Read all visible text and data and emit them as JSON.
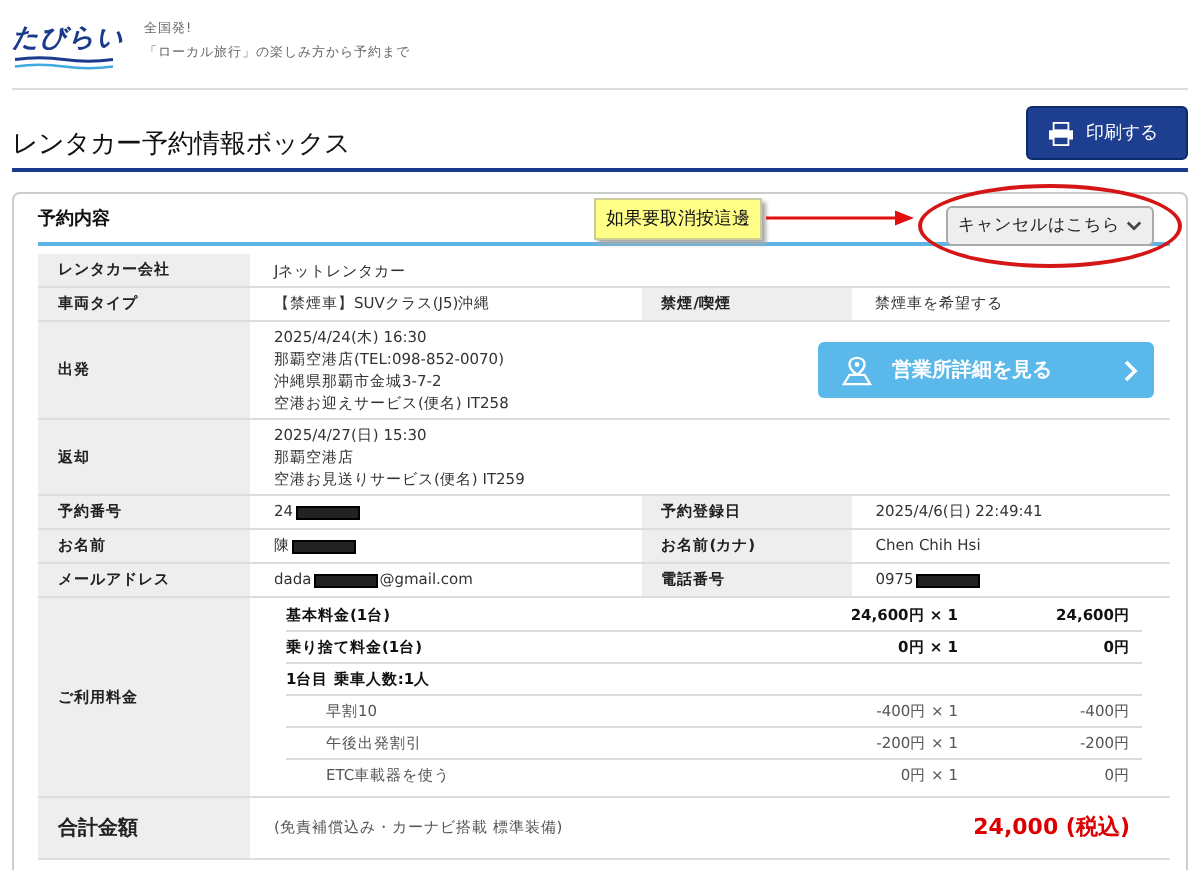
{
  "logo": {
    "text": "たびらい"
  },
  "tagline": [
    "全国発!",
    "「ローカル旅行」の楽しみ方から予約まで"
  ],
  "page_title": "レンタカー予約情報ボックス",
  "print_button": "印刷する",
  "section": {
    "title": "予約内容",
    "cancel_button": "キャンセルはこちら",
    "annotation": "如果要取消按這邊"
  },
  "details": [
    {
      "kind": "single",
      "label": "レンタカー会社",
      "lines": [
        "Jネットレンタカー"
      ]
    },
    {
      "kind": "pair",
      "label": "車両タイプ",
      "value": [
        {
          "kind": "text",
          "text": "【禁煙車】SUVクラス(J5)沖縄"
        }
      ],
      "label2": "禁煙/喫煙",
      "value2": [
        {
          "kind": "text",
          "text": "禁煙車を希望する"
        }
      ]
    },
    {
      "kind": "shop",
      "label": "出発",
      "lines": [
        "2025/4/24(木) 16:30",
        "那覇空港店(TEL:098-852-0070)",
        "沖縄県那覇市金城3-7-2",
        "空港お迎えサービス(便名) IT258"
      ],
      "button": "営業所詳細を見る"
    },
    {
      "kind": "single",
      "label": "返却",
      "lines": [
        "2025/4/27(日) 15:30",
        "那覇空港店",
        "空港お見送りサービス(便名) IT259"
      ]
    },
    {
      "kind": "pair",
      "label": "予約番号",
      "value": [
        {
          "kind": "text",
          "text": "24"
        },
        {
          "kind": "redacted"
        }
      ],
      "label2": "予約登録日",
      "value2": [
        {
          "kind": "text",
          "text": "2025/4/6(日) 22:49:41"
        }
      ]
    },
    {
      "kind": "pair",
      "label": "お名前",
      "value": [
        {
          "kind": "text",
          "text": "陳"
        },
        {
          "kind": "redacted"
        }
      ],
      "label2": "お名前(カナ)",
      "value2": [
        {
          "kind": "text",
          "text": "Chen Chih Hsi"
        }
      ]
    },
    {
      "kind": "pair",
      "label": "メールアドレス",
      "value": [
        {
          "kind": "text",
          "text": "dada"
        },
        {
          "kind": "redacted"
        },
        {
          "kind": "text",
          "text": "@gmail.com"
        }
      ],
      "label2": "電話番号",
      "value2": [
        {
          "kind": "text",
          "text": "0975"
        },
        {
          "kind": "redacted"
        }
      ]
    }
  ],
  "fees": {
    "label": "ご利用料金",
    "rows": [
      {
        "kind": "item",
        "name": "基本料金(1台)",
        "unit": "24,600円 × 1",
        "total": "24,600円"
      },
      {
        "kind": "item",
        "name": "乗り捨て料金(1台)",
        "unit": "0円 × 1",
        "total": "0円"
      },
      {
        "kind": "group",
        "name": "1台目 乗車人数:1人"
      },
      {
        "kind": "option",
        "name": "早割10",
        "unit": "-400円 × 1",
        "total": "-400円"
      },
      {
        "kind": "option",
        "name": "午後出発割引",
        "unit": "-200円 × 1",
        "total": "-200円"
      },
      {
        "kind": "option",
        "name": "ETC車載器を使う",
        "unit": "0円 × 1",
        "total": "0円"
      }
    ]
  },
  "total": {
    "label": "合計金額",
    "note": "(免責補償込み・カーナビ搭載 標準装備)",
    "amount": "24,000 (税込)"
  }
}
